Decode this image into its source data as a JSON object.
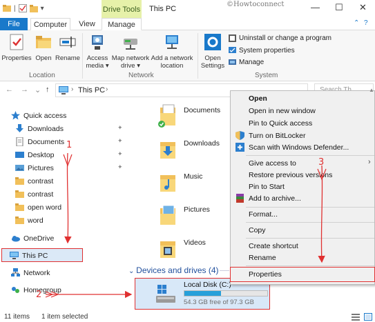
{
  "window": {
    "title": "This PC",
    "contextual_tab": "Drive Tools",
    "watermark": "©Howtoconnect",
    "minimize": "—",
    "maximize": "☐",
    "close": "✕",
    "qat_divider": "|",
    "qat_dropdown": "▾"
  },
  "tabs": {
    "file": "File",
    "computer": "Computer",
    "view": "View",
    "manage": "Manage",
    "collapse": "⌃",
    "help": "?"
  },
  "ribbon": {
    "location": {
      "label": "Location",
      "properties": "Properties",
      "open": "Open",
      "rename": "Rename"
    },
    "network": {
      "label": "Network",
      "access_media_1": "Access",
      "access_media_2": "media ▾",
      "map_drive_1": "Map network",
      "map_drive_2": "drive ▾",
      "add_location_1": "Add a network",
      "add_location_2": "location"
    },
    "system": {
      "label": "System",
      "open_settings_1": "Open",
      "open_settings_2": "Settings",
      "uninstall": "Uninstall or change a program",
      "system_properties": "System properties",
      "manage": "Manage"
    }
  },
  "address": {
    "back": "←",
    "forward": "→",
    "recent": "⌄",
    "up": "↑",
    "path_chevron": "›",
    "path": "This PC",
    "path_end": "›",
    "search_placeholder": "Search Th"
  },
  "nav": {
    "quick_access": "Quick access",
    "items": [
      {
        "label": "Downloads"
      },
      {
        "label": "Documents"
      },
      {
        "label": "Desktop"
      },
      {
        "label": "Pictures"
      },
      {
        "label": "contrast"
      },
      {
        "label": "contrast"
      },
      {
        "label": "open word"
      },
      {
        "label": "word"
      }
    ],
    "onedrive": "OneDrive",
    "this_pc": "This PC",
    "network": "Network",
    "homegroup": "Homegroup"
  },
  "folders": [
    {
      "label": "Documents"
    },
    {
      "label": "Downloads"
    },
    {
      "label": "Music"
    },
    {
      "label": "Pictures"
    },
    {
      "label": "Videos"
    }
  ],
  "devices": {
    "heading": "Devices and drives (4)",
    "drive_name": "Local Disk (C:)",
    "drive_free": "54.3 GB free of 97.3 GB",
    "free_gb": 54.3,
    "total_gb": 97.3
  },
  "context_menu": {
    "open": "Open",
    "open_new_window": "Open in new window",
    "pin_quick_access": "Pin to Quick access",
    "bitlocker": "Turn on BitLocker",
    "defender": "Scan with Windows Defender...",
    "give_access": "Give access to",
    "restore_versions": "Restore previous versions",
    "pin_start": "Pin to Start",
    "add_archive": "Add to archive...",
    "format": "Format...",
    "copy": "Copy",
    "create_shortcut": "Create shortcut",
    "rename": "Rename",
    "properties": "Properties",
    "submenu_arrow": "›"
  },
  "annotations": {
    "step1": "1",
    "step2": "2",
    "step3": "3"
  },
  "status": {
    "items": "11 items",
    "selected": "1 item selected"
  },
  "colors": {
    "accent": "#1979ca",
    "drive_tools": "#e6f1a9",
    "annotation": "#e03030",
    "drive_bar": "#26a0da"
  }
}
